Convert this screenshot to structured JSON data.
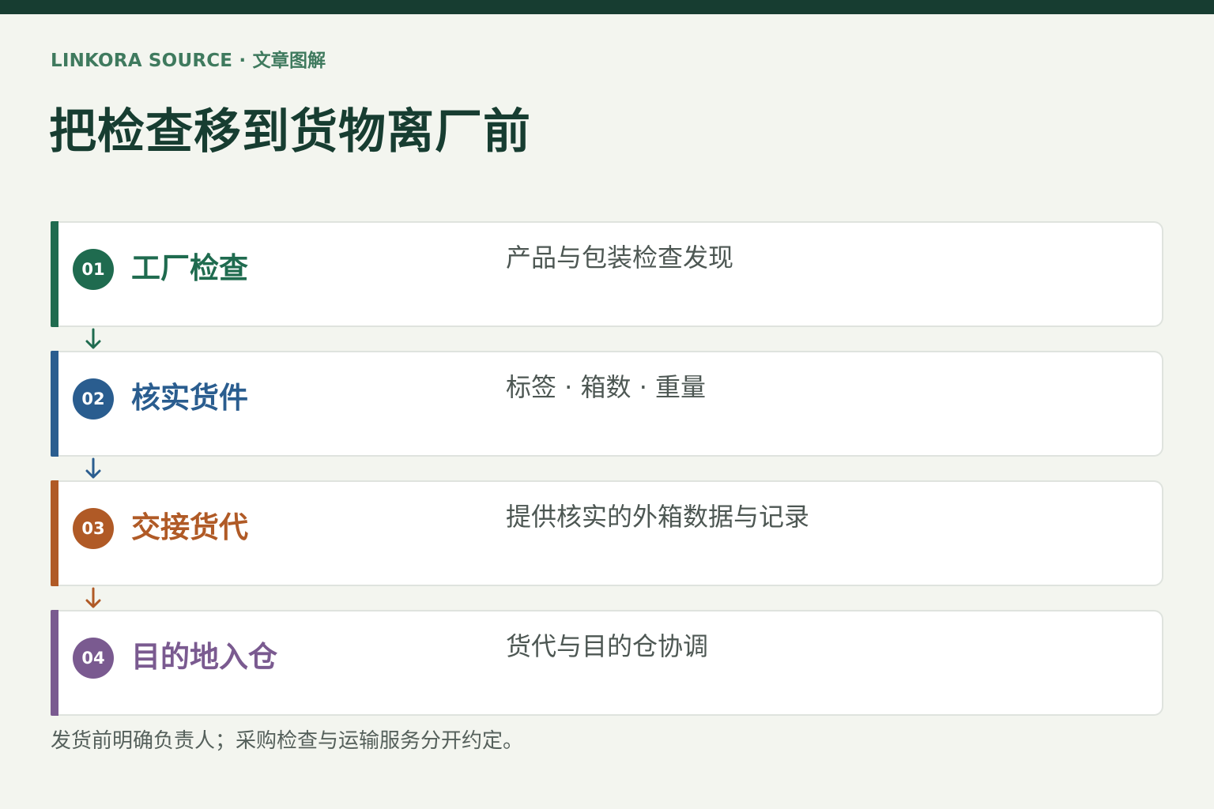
{
  "header": {
    "eyebrow": "LINKORA SOURCE · 文章图解",
    "title": "把检查移到货物离厂前"
  },
  "steps": [
    {
      "number": "01",
      "title": "工厂检查",
      "description": "产品与包装检查发现",
      "color": "#1f6b4f"
    },
    {
      "number": "02",
      "title": "核实货件",
      "description": "标签 · 箱数 · 重量",
      "color": "#2a5d8f"
    },
    {
      "number": "03",
      "title": "交接货代",
      "description": "提供核实的外箱数据与记录",
      "color": "#b05a26"
    },
    {
      "number": "04",
      "title": "目的地入仓",
      "description": "货代与目的仓协调",
      "color": "#7a5a90"
    }
  ],
  "footnote": "发货前明确负责人；采购检查与运输服务分开约定。",
  "colors": {
    "background": "#f3f5ef",
    "top_bar": "#173d31",
    "title": "#173d31",
    "eyebrow": "#3f7a5e"
  }
}
